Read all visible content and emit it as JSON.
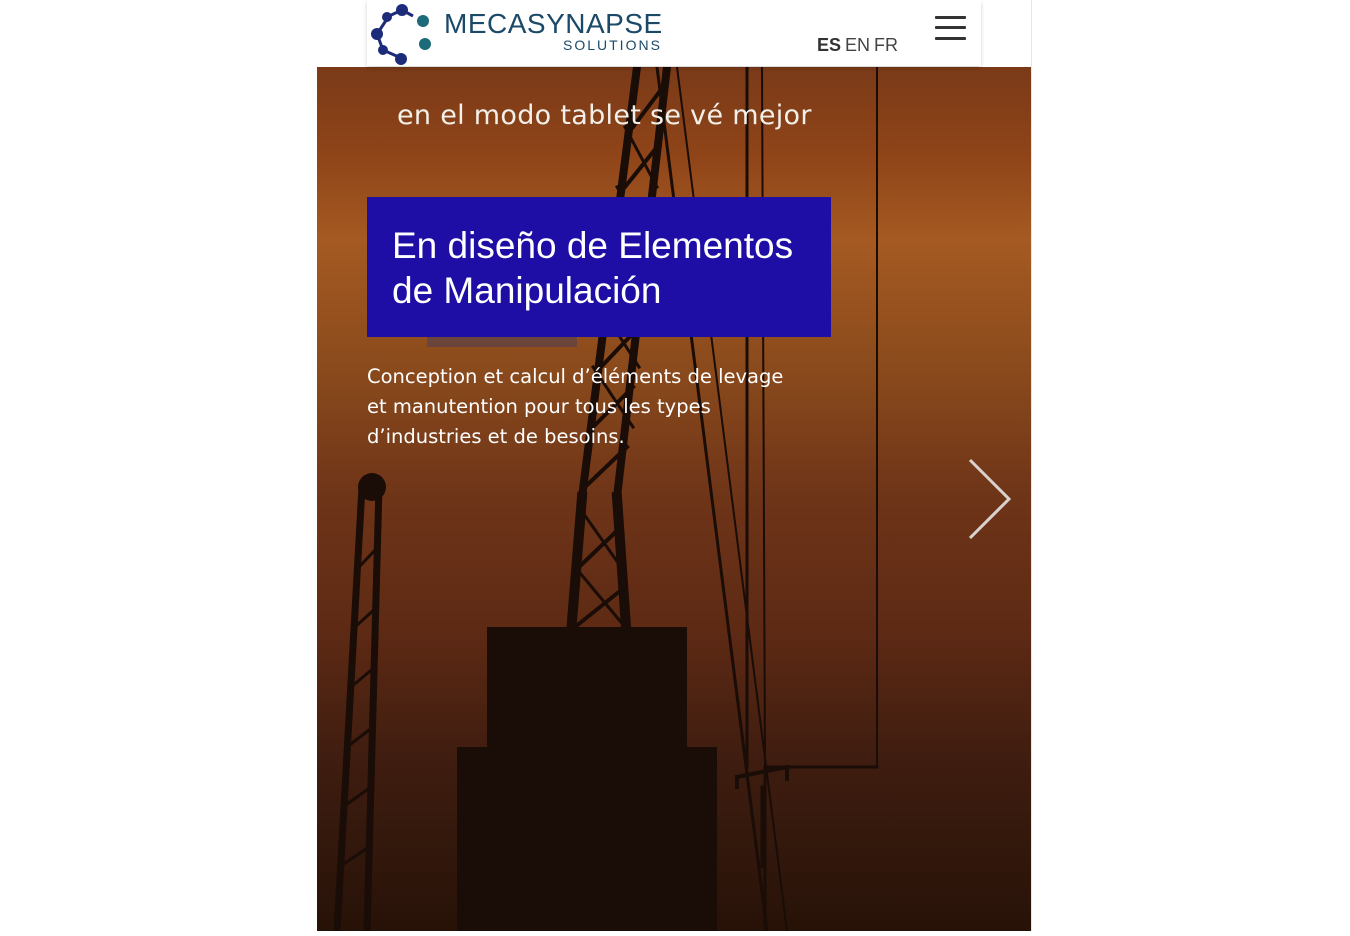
{
  "brand": {
    "name": "MECASYNAPSE",
    "subtitle": "SOLUTIONS"
  },
  "languages": [
    {
      "code": "ES",
      "active": true
    },
    {
      "code": "EN",
      "active": false
    },
    {
      "code": "FR",
      "active": false
    }
  ],
  "hero": {
    "note": "en el modo tablet se vé mejor",
    "headline": "En diseño de Elementos de Manipulación",
    "description": "Conception et calcul d’éléments de levage et manutention pour tous les types d’industries et de besoins."
  },
  "icons": {
    "menu": "hamburger-icon",
    "next": "chevron-right-icon",
    "logo": "molecule-logo-icon"
  },
  "colors": {
    "brand_dark": "#1b4968",
    "logo_dot_blue": "#1d2c7a",
    "logo_dot_teal": "#1c6a7a",
    "headline_box": "#1f0ea6",
    "hero_sky": "#8e4418"
  }
}
